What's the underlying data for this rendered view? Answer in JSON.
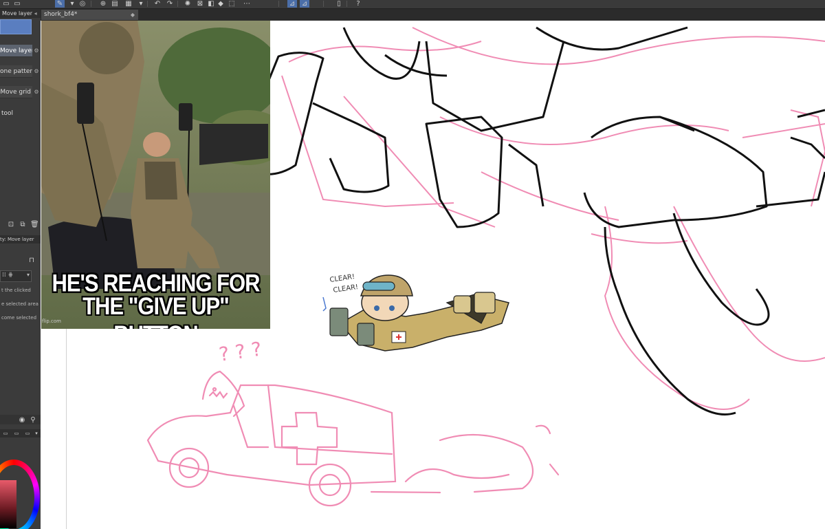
{
  "app": {
    "panel_tab_label": "Move layer",
    "document_tab": "shork_bf4*",
    "document_tab_close": "◆"
  },
  "tool_panel": {
    "subtools": [
      "Move layer",
      "one pattern",
      "Move grid"
    ],
    "tool_label": "tool",
    "property_title": "ty: Move layer",
    "options": [
      "t the clicked",
      "e selected area",
      "come selected"
    ]
  },
  "meme": {
    "caption_line1": "HE'S REACHING FOR",
    "caption_line2": "THE \"GIVE UP\" BUTTON",
    "watermark": "flip.com"
  },
  "sketch": {
    "clear_1": "CLEAR!",
    "clear_2": "CLEAR!",
    "question_marks": "? ? ?"
  },
  "colors": {
    "accent_blue": "#5a7ec0",
    "sketch_pink": "#f08cb4",
    "line_black": "#111111",
    "panel_bg": "#3b3b3b"
  },
  "icons": [
    "pen-tool-icon",
    "grid-icon",
    "undo-icon",
    "redo-icon",
    "fill-icon",
    "lock-icon",
    "new-layer-icon",
    "copy-layer-icon",
    "trash-icon",
    "magnify-icon"
  ]
}
